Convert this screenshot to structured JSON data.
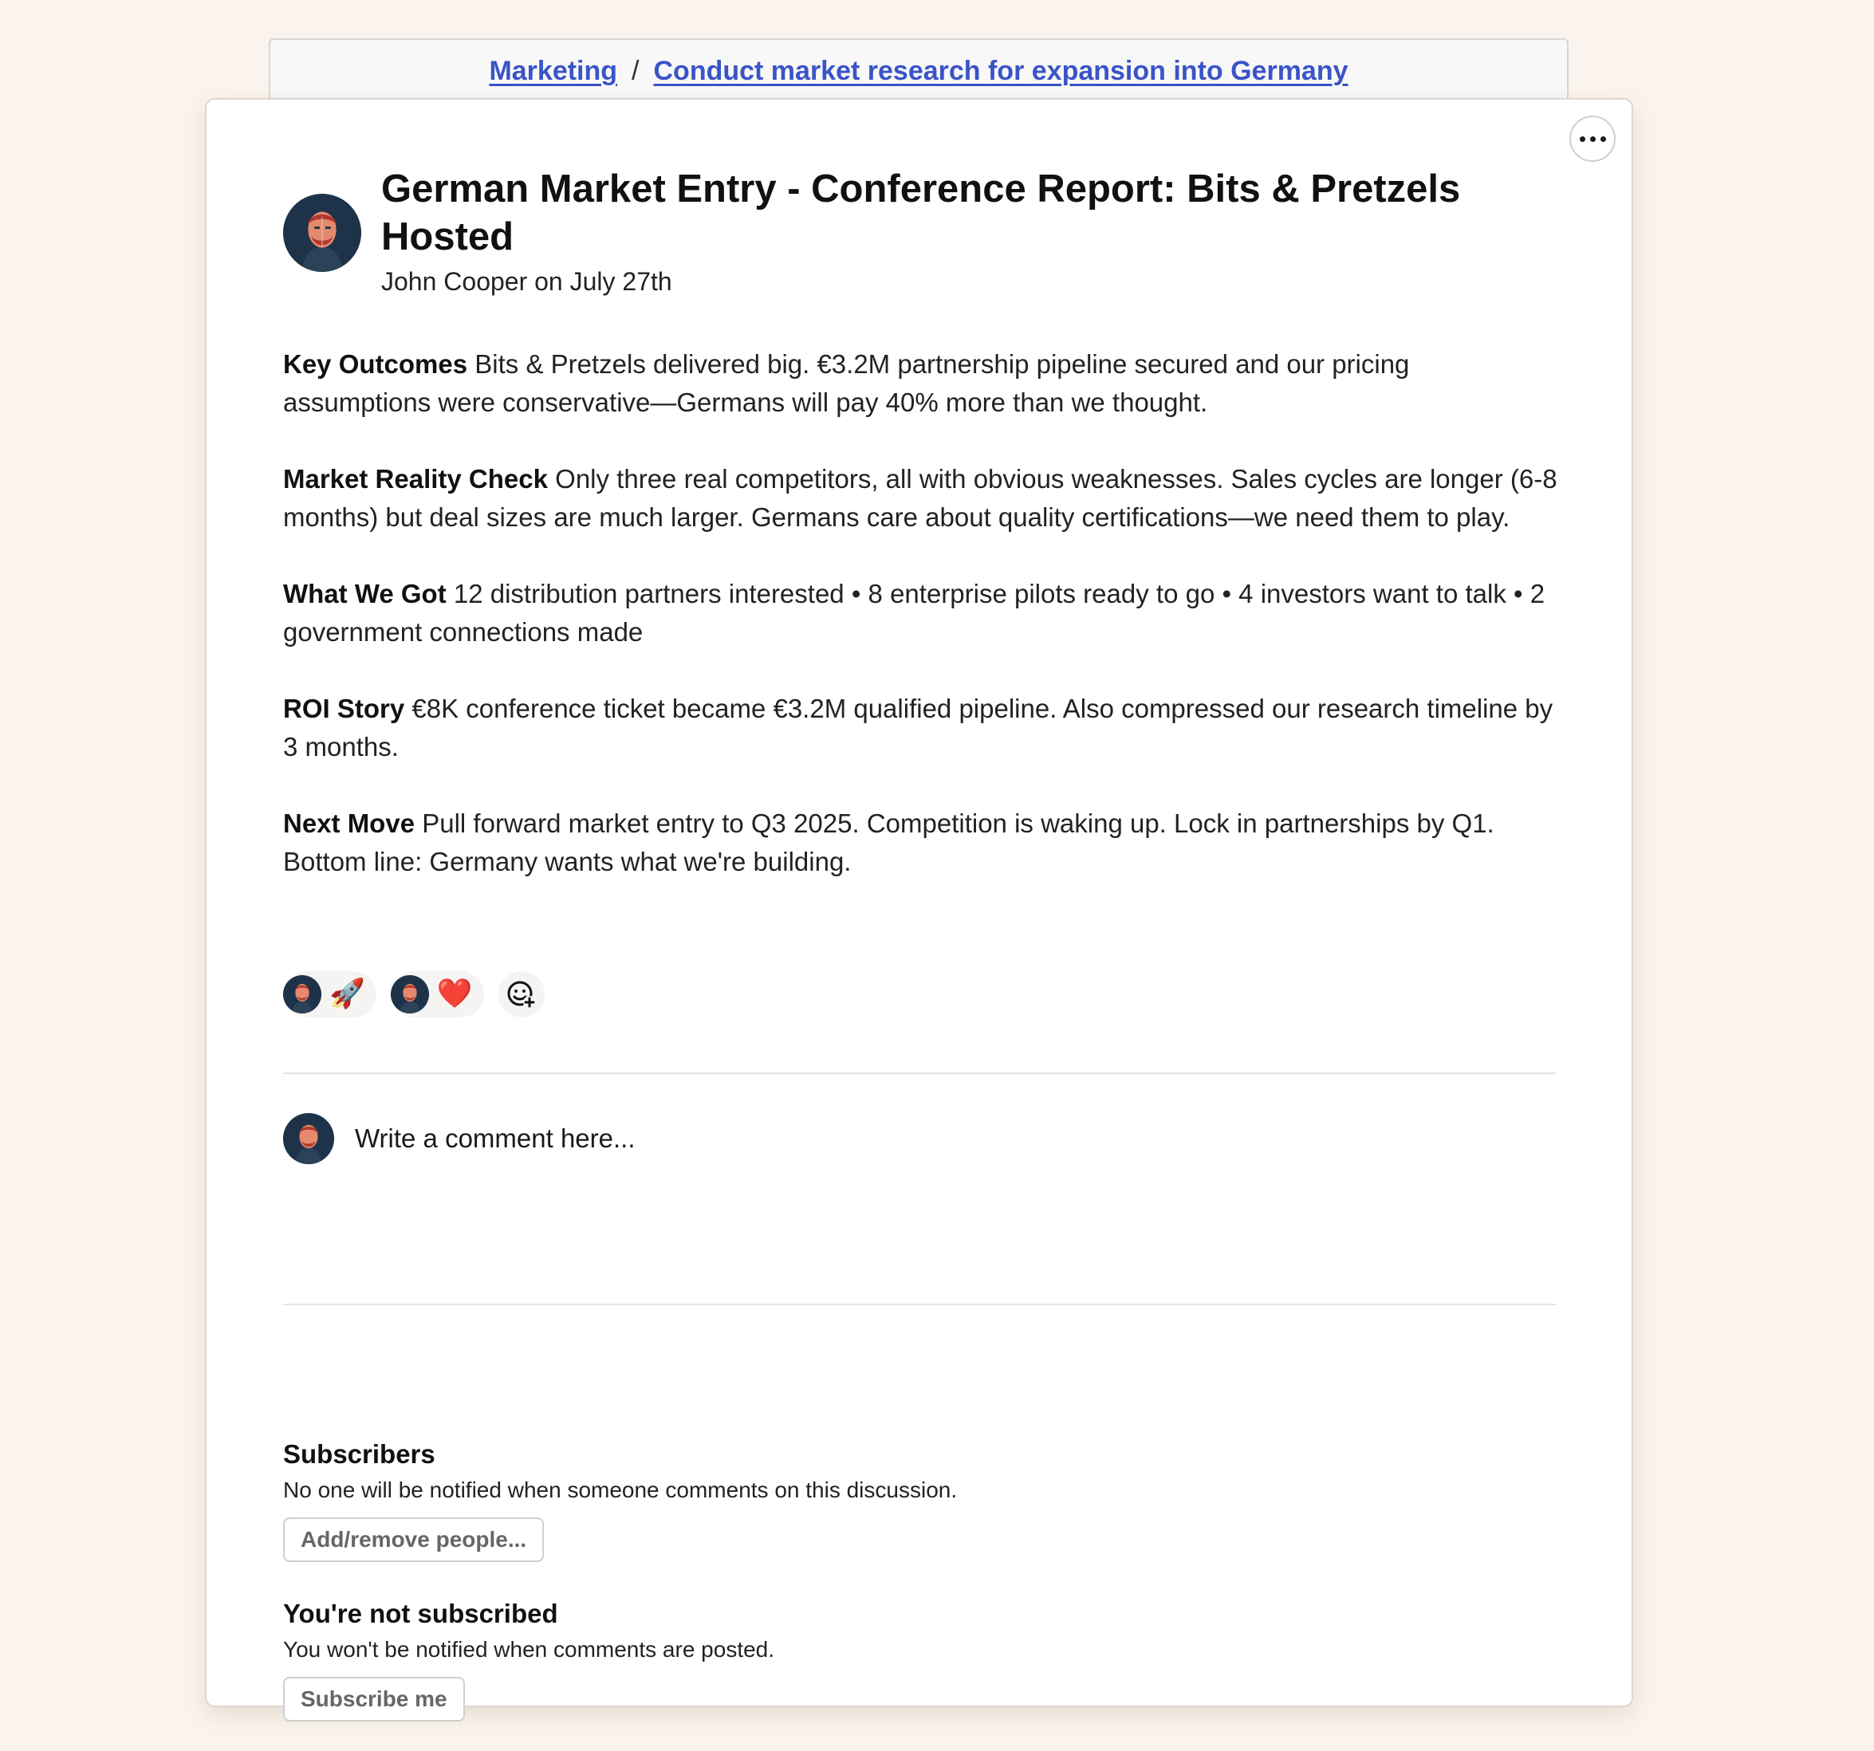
{
  "breadcrumb": {
    "parent": "Marketing",
    "separator": "/",
    "current": "Conduct market research for expansion into Germany"
  },
  "post": {
    "title": "German Market Entry - Conference Report: Bits & Pretzels Hosted",
    "byline": "John Cooper on July 27th",
    "sections": [
      {
        "heading": "Key Outcomes",
        "text": "Bits & Pretzels delivered big. €3.2M partnership pipeline secured and our pricing assumptions were conservative—Germans will pay 40% more than we thought."
      },
      {
        "heading": "Market Reality Check",
        "text": "Only three real competitors, all with obvious weaknesses. Sales cycles are longer (6-8 months) but deal sizes are much larger. Germans care about quality certifications—we need them to play."
      },
      {
        "heading": "What We Got",
        "text": "12 distribution partners interested • 8 enterprise pilots ready to go • 4 investors want to talk • 2 government connections made"
      },
      {
        "heading": "ROI Story",
        "text": "€8K conference ticket became €3.2M qualified pipeline. Also compressed our research timeline by 3 months."
      },
      {
        "heading": "Next Move",
        "text": "Pull forward market entry to Q3 2025. Competition is waking up. Lock in partnerships by Q1. Bottom line: Germany wants what we're building."
      }
    ]
  },
  "reactions": [
    {
      "emoji": "🚀",
      "icon": "rocket-icon"
    },
    {
      "emoji": "❤️",
      "icon": "heart-icon"
    }
  ],
  "add_reaction_icon": "add-emoji-icon",
  "comment": {
    "placeholder": "Write a comment here..."
  },
  "subscribers": {
    "title": "Subscribers",
    "description": "No one will be notified when someone comments on this discussion.",
    "button_label": "Add/remove people..."
  },
  "subscription": {
    "title": "You're not subscribed",
    "description": "You won't be notified when comments are posted.",
    "button_label": "Subscribe me"
  },
  "colors": {
    "background": "#fbf4ee",
    "link": "#3a54c8",
    "avatar_bg": "#1e3349"
  }
}
